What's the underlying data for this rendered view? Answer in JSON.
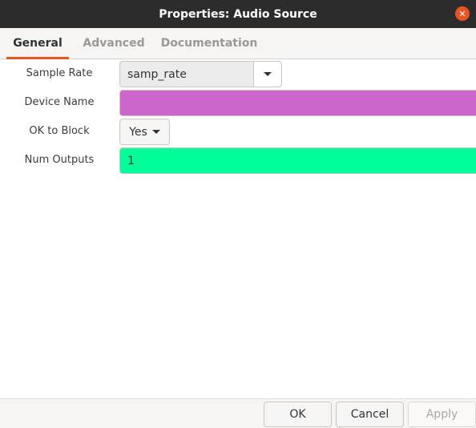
{
  "window": {
    "title": "Properties: Audio Source",
    "close_symbol": "✕"
  },
  "tabs": [
    {
      "label": "General",
      "active": true
    },
    {
      "label": "Advanced",
      "active": false
    },
    {
      "label": "Documentation",
      "active": false
    }
  ],
  "fields": {
    "sample_rate": {
      "label": "Sample Rate",
      "value": "samp_rate"
    },
    "device_name": {
      "label": "Device Name",
      "value": "",
      "color": "#cc66cc"
    },
    "ok_to_block": {
      "label": "OK to Block",
      "value": "Yes"
    },
    "num_outputs": {
      "label": "Num Outputs",
      "value": "1",
      "color": "#00ff99"
    }
  },
  "buttons": {
    "ok": "OK",
    "cancel": "Cancel",
    "apply": "Apply"
  },
  "colors": {
    "accent": "#e95420",
    "titlebar": "#2c2c2c"
  }
}
